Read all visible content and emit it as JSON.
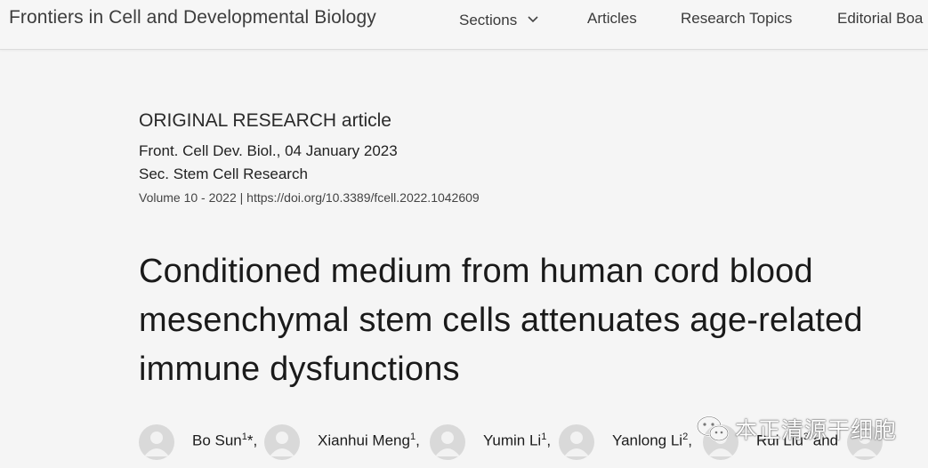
{
  "header": {
    "journal_name": "Frontiers in Cell and Developmental Biology",
    "nav": {
      "sections": "Sections",
      "articles": "Articles",
      "research_topics": "Research Topics",
      "editorial_board": "Editorial Boa"
    }
  },
  "article": {
    "type_label": "ORIGINAL RESEARCH article",
    "journal_date": "Front. Cell Dev. Biol., 04 January 2023",
    "section": "Sec. Stem Cell Research",
    "volume_doi": "Volume 10 - 2022 | https://doi.org/10.3389/fcell.2022.1042609",
    "title": "Conditioned medium from human cord blood mesenchymal stem cells attenuates age-related immune dysfunctions"
  },
  "authors": [
    {
      "name": "Bo Sun",
      "sup": "1",
      "suffix": "*,"
    },
    {
      "name": "Xianhui Meng",
      "sup": "1",
      "suffix": ","
    },
    {
      "name": "Yumin Li",
      "sup": "1",
      "suffix": ","
    },
    {
      "name": "Yanlong Li",
      "sup": "2",
      "suffix": ","
    },
    {
      "name": "Rui Liu",
      "sup": "3",
      "suffix": " and"
    }
  ],
  "watermark": {
    "text": "本正清源干细胞",
    "icon": "wechat-icon"
  },
  "colors": {
    "background": "#f5f5f5",
    "topbar": "#f6f6f6",
    "avatar": "#d9d9d9"
  }
}
